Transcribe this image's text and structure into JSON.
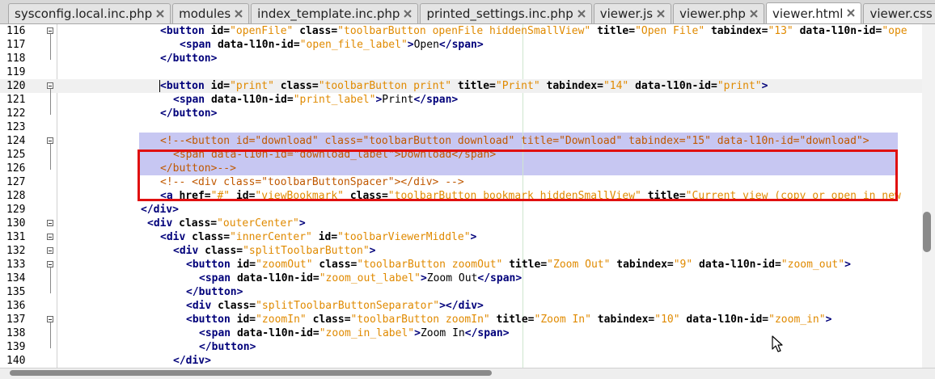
{
  "tabs": [
    {
      "label": "sysconfig.local.inc.php",
      "active": false
    },
    {
      "label": "modules",
      "active": false
    },
    {
      "label": "index_template.inc.php",
      "active": false
    },
    {
      "label": "printed_settings.inc.php",
      "active": false
    },
    {
      "label": "viewer.js",
      "active": false
    },
    {
      "label": "viewer.php",
      "active": false
    },
    {
      "label": "viewer.html",
      "active": true
    },
    {
      "label": "viewer.css",
      "active": false
    }
  ],
  "icons": {
    "tab_close": "close-x-icon",
    "fold": "fold-minus-icon",
    "pointer": "mouse-pointer-icon"
  },
  "colors": {
    "tag": "#00007a",
    "attribute": "#000000",
    "value": "#e08a00",
    "comment": "#c05800",
    "selection": "#c7c7f2",
    "annotation_box": "#e01010"
  },
  "editor": {
    "current_line": 120,
    "selected_lines": [
      124,
      125,
      126
    ],
    "highlighted_lines": [
      124,
      125,
      126
    ],
    "lines": [
      {
        "num": "116",
        "fold": true,
        "segs": [
          [
            "t",
            "<button "
          ],
          [
            "a",
            "id="
          ],
          [
            "v",
            "\"openFile\""
          ],
          [
            "x",
            " "
          ],
          [
            "a",
            "class="
          ],
          [
            "v",
            "\"toolbarButton openFile hiddenSmallView\""
          ],
          [
            "x",
            " "
          ],
          [
            "a",
            "title="
          ],
          [
            "v",
            "\"Open File\""
          ],
          [
            "x",
            " "
          ],
          [
            "a",
            "tabindex="
          ],
          [
            "v",
            "\"13\""
          ],
          [
            "x",
            " "
          ],
          [
            "a",
            "data-l10n-id="
          ],
          [
            "v",
            "\"ope"
          ]
        ]
      },
      {
        "num": "117",
        "fold": false,
        "segs": [
          [
            "t",
            "<span "
          ],
          [
            "a",
            "data-l10n-id="
          ],
          [
            "v",
            "\"open_file_label\""
          ],
          [
            "t",
            ">"
          ],
          [
            "x",
            "Open"
          ],
          [
            "t",
            "</span>"
          ]
        ]
      },
      {
        "num": "118",
        "fold": false,
        "segs": [
          [
            "t",
            "</button>"
          ]
        ]
      },
      {
        "num": "119",
        "fold": false,
        "segs": []
      },
      {
        "num": "120",
        "fold": true,
        "segs": [
          [
            "t",
            "<button "
          ],
          [
            "a",
            "id="
          ],
          [
            "v",
            "\"print\""
          ],
          [
            "x",
            " "
          ],
          [
            "a",
            "class="
          ],
          [
            "v",
            "\"toolbarButton print\""
          ],
          [
            "x",
            " "
          ],
          [
            "a",
            "title="
          ],
          [
            "v",
            "\"Print\""
          ],
          [
            "x",
            " "
          ],
          [
            "a",
            "tabindex="
          ],
          [
            "v",
            "\"14\""
          ],
          [
            "x",
            " "
          ],
          [
            "a",
            "data-l10n-id="
          ],
          [
            "v",
            "\"print\""
          ],
          [
            "t",
            ">"
          ]
        ]
      },
      {
        "num": "121",
        "fold": false,
        "segs": [
          [
            "t",
            "<span "
          ],
          [
            "a",
            "data-l10n-id="
          ],
          [
            "v",
            "\"print_label\""
          ],
          [
            "t",
            ">"
          ],
          [
            "x",
            "Print"
          ],
          [
            "t",
            "</span>"
          ]
        ]
      },
      {
        "num": "122",
        "fold": false,
        "segs": [
          [
            "t",
            "</button>"
          ]
        ]
      },
      {
        "num": "123",
        "fold": false,
        "segs": []
      },
      {
        "num": "124",
        "fold": true,
        "segs": [
          [
            "c",
            "<!--<button id=\"download\" class=\"toolbarButton download\" title=\"Download\" tabindex=\"15\" data-l10n-id=\"download\">"
          ]
        ]
      },
      {
        "num": "125",
        "fold": false,
        "segs": [
          [
            "c",
            "<span data-l10n-id=\"download_label\">Download</span>"
          ]
        ]
      },
      {
        "num": "126",
        "fold": false,
        "segs": [
          [
            "c",
            "</button>-->"
          ]
        ]
      },
      {
        "num": "127",
        "fold": false,
        "segs": [
          [
            "c",
            "<!-- <div class=\"toolbarButtonSpacer\"></div> -->"
          ]
        ]
      },
      {
        "num": "128",
        "fold": false,
        "segs": [
          [
            "t",
            "<a "
          ],
          [
            "a",
            "href="
          ],
          [
            "v",
            "\"#\""
          ],
          [
            "x",
            " "
          ],
          [
            "a",
            "id="
          ],
          [
            "v",
            "\"viewBookmark\""
          ],
          [
            "x",
            " "
          ],
          [
            "a",
            "class="
          ],
          [
            "v",
            "\"toolbarButton bookmark hiddenSmallView\""
          ],
          [
            "x",
            " "
          ],
          [
            "a",
            "title="
          ],
          [
            "v",
            "\"Current view (copy or open in new"
          ]
        ]
      },
      {
        "num": "129",
        "fold": false,
        "segs": [
          [
            "t",
            "</div>"
          ]
        ]
      },
      {
        "num": "130",
        "fold": true,
        "segs": [
          [
            "t",
            "<div "
          ],
          [
            "a",
            "class="
          ],
          [
            "v",
            "\"outerCenter\""
          ],
          [
            "t",
            ">"
          ]
        ]
      },
      {
        "num": "131",
        "fold": true,
        "segs": [
          [
            "t",
            "<div "
          ],
          [
            "a",
            "class="
          ],
          [
            "v",
            "\"innerCenter\""
          ],
          [
            "x",
            " "
          ],
          [
            "a",
            "id="
          ],
          [
            "v",
            "\"toolbarViewerMiddle\""
          ],
          [
            "t",
            ">"
          ]
        ]
      },
      {
        "num": "132",
        "fold": true,
        "segs": [
          [
            "t",
            "<div "
          ],
          [
            "a",
            "class="
          ],
          [
            "v",
            "\"splitToolbarButton\""
          ],
          [
            "t",
            ">"
          ]
        ]
      },
      {
        "num": "133",
        "fold": true,
        "segs": [
          [
            "t",
            "<button "
          ],
          [
            "a",
            "id="
          ],
          [
            "v",
            "\"zoomOut\""
          ],
          [
            "x",
            " "
          ],
          [
            "a",
            "class="
          ],
          [
            "v",
            "\"toolbarButton zoomOut\""
          ],
          [
            "x",
            " "
          ],
          [
            "a",
            "title="
          ],
          [
            "v",
            "\"Zoom Out\""
          ],
          [
            "x",
            " "
          ],
          [
            "a",
            "tabindex="
          ],
          [
            "v",
            "\"9\""
          ],
          [
            "x",
            " "
          ],
          [
            "a",
            "data-l10n-id="
          ],
          [
            "v",
            "\"zoom_out\""
          ],
          [
            "t",
            ">"
          ]
        ]
      },
      {
        "num": "134",
        "fold": false,
        "segs": [
          [
            "t",
            "<span "
          ],
          [
            "a",
            "data-l10n-id="
          ],
          [
            "v",
            "\"zoom_out_label\""
          ],
          [
            "t",
            ">"
          ],
          [
            "x",
            "Zoom Out"
          ],
          [
            "t",
            "</span>"
          ]
        ]
      },
      {
        "num": "135",
        "fold": false,
        "segs": [
          [
            "t",
            "</button>"
          ]
        ]
      },
      {
        "num": "136",
        "fold": false,
        "segs": [
          [
            "t",
            "<div "
          ],
          [
            "a",
            "class="
          ],
          [
            "v",
            "\"splitToolbarButtonSeparator\""
          ],
          [
            "t",
            "></div>"
          ]
        ]
      },
      {
        "num": "137",
        "fold": true,
        "segs": [
          [
            "t",
            "<button "
          ],
          [
            "a",
            "id="
          ],
          [
            "v",
            "\"zoomIn\""
          ],
          [
            "x",
            " "
          ],
          [
            "a",
            "class="
          ],
          [
            "v",
            "\"toolbarButton zoomIn\""
          ],
          [
            "x",
            " "
          ],
          [
            "a",
            "title="
          ],
          [
            "v",
            "\"Zoom In\""
          ],
          [
            "x",
            " "
          ],
          [
            "a",
            "tabindex="
          ],
          [
            "v",
            "\"10\""
          ],
          [
            "x",
            " "
          ],
          [
            "a",
            "data-l10n-id="
          ],
          [
            "v",
            "\"zoom_in\""
          ],
          [
            "t",
            ">"
          ]
        ]
      },
      {
        "num": "138",
        "fold": false,
        "segs": [
          [
            "t",
            "<span "
          ],
          [
            "a",
            "data-l10n-id="
          ],
          [
            "v",
            "\"zoom_in_label\""
          ],
          [
            "t",
            ">"
          ],
          [
            "x",
            "Zoom In"
          ],
          [
            "t",
            "</span>"
          ]
        ]
      },
      {
        "num": "139",
        "fold": false,
        "segs": [
          [
            "t",
            "</button>"
          ]
        ]
      },
      {
        "num": "140",
        "fold": false,
        "segs": [
          [
            "t",
            "</div>"
          ]
        ]
      }
    ]
  }
}
